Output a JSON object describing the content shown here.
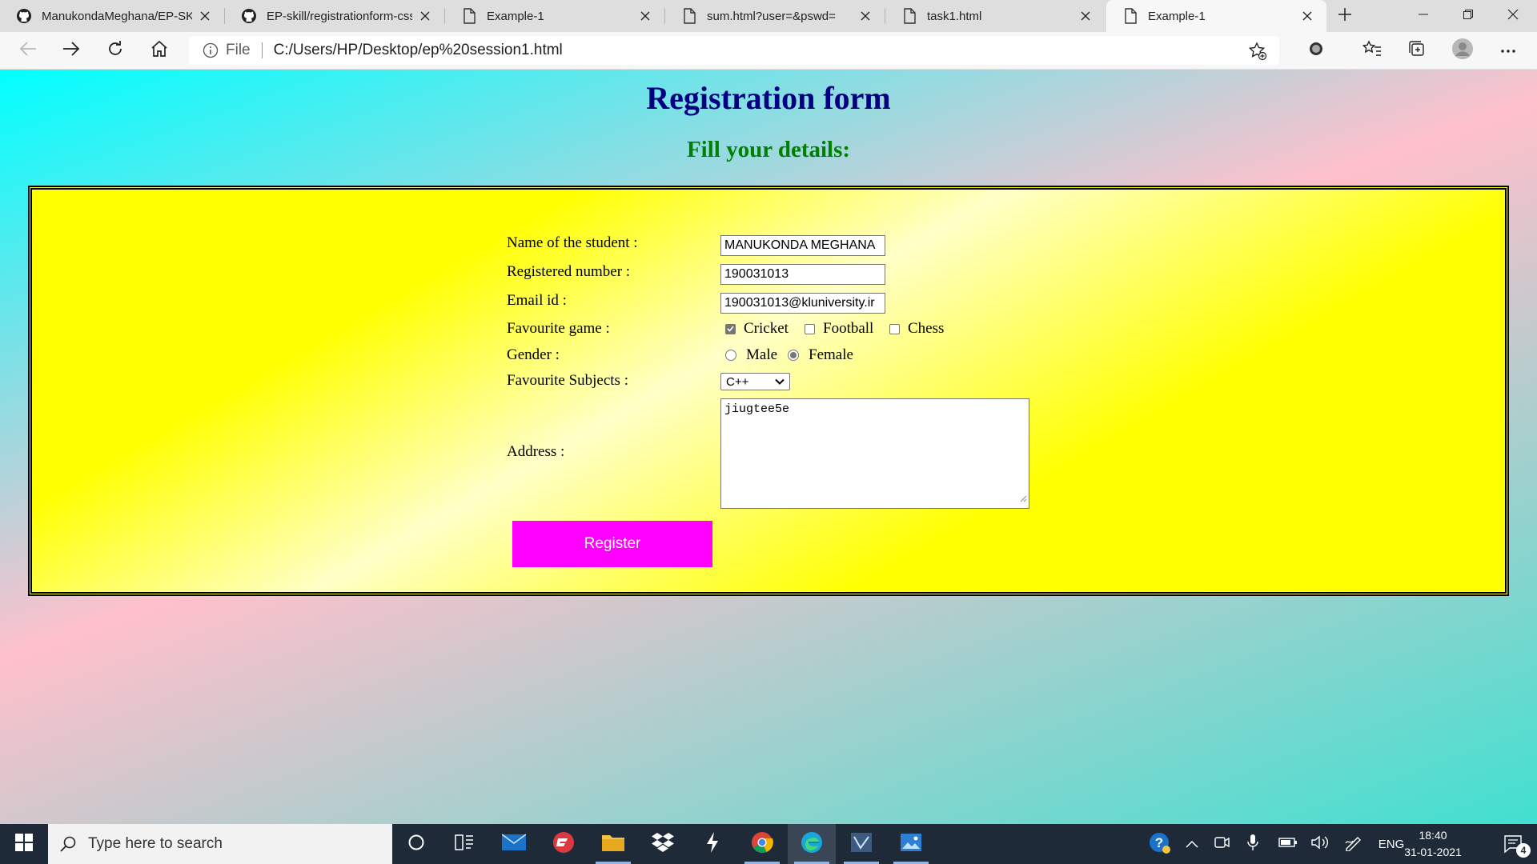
{
  "browser": {
    "tabs": [
      {
        "label": "ManukondaMeghana/EP-SKI",
        "icon": "github-icon",
        "active": false
      },
      {
        "label": "EP-skill/registrationform-css.",
        "icon": "github-icon",
        "active": false
      },
      {
        "label": "Example-1",
        "icon": "page-icon",
        "active": false
      },
      {
        "label": "sum.html?user=&pswd=",
        "icon": "page-icon",
        "active": false
      },
      {
        "label": "task1.html",
        "icon": "page-icon",
        "active": false
      },
      {
        "label": "Example-1",
        "icon": "page-icon",
        "active": true
      }
    ],
    "address": {
      "scheme_label": "File",
      "url": "C:/Users/HP/Desktop/ep%20session1.html"
    }
  },
  "page": {
    "title": "Registration form",
    "subtitle": "Fill your details:",
    "colors": {
      "title": "#000080",
      "subtitle": "#008000",
      "form_background": "#ffff00",
      "register_button": "#ff00ff"
    },
    "form": {
      "name_label": "Name of the student :",
      "name_value": "MANUKONDA MEGHANA",
      "regno_label": "Registered number :",
      "regno_value": "190031013",
      "email_label": "Email id :",
      "email_value": "190031013@kluniversity.ir",
      "game_label": "Favourite game :",
      "games": [
        {
          "label": "Cricket",
          "checked": true
        },
        {
          "label": "Football",
          "checked": false
        },
        {
          "label": "Chess",
          "checked": false
        }
      ],
      "gender_label": "Gender :",
      "genders": [
        {
          "label": "Male",
          "selected": false
        },
        {
          "label": "Female",
          "selected": true
        }
      ],
      "subjects_label": "Favourite Subjects :",
      "subject_selected": "C++",
      "address_label": "Address :",
      "address_value": "jiugtee5e",
      "register_label": "Register"
    }
  },
  "taskbar": {
    "search_placeholder": "Type here to search",
    "apps": [
      "cortana-icon",
      "task-view-icon",
      "mail-icon",
      "express-vpn-icon",
      "file-explorer-icon",
      "dropbox-icon",
      "bolt-app-icon",
      "chrome-icon",
      "edge-icon",
      "code-editor-icon",
      "photos-icon"
    ],
    "language": "ENG",
    "time": "18:40",
    "date": "31-01-2021",
    "notification_count": "4"
  }
}
